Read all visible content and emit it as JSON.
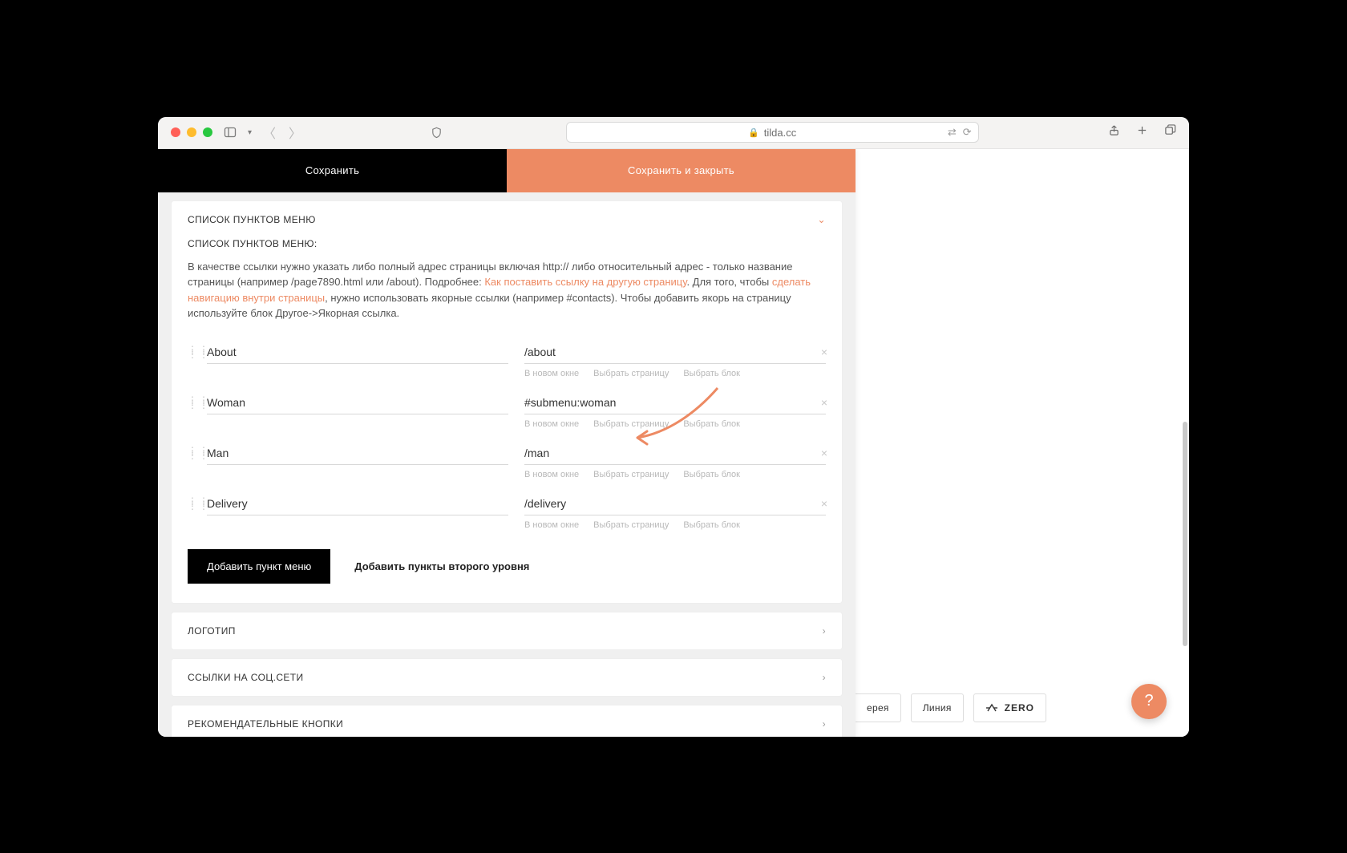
{
  "browser": {
    "url_host": "tilda.cc",
    "translate_icon": "translate-icon",
    "reload_icon": "reload-icon"
  },
  "modal": {
    "save_label": "Сохранить",
    "save_close_label": "Сохранить и закрыть"
  },
  "menu_section": {
    "title": "СПИСОК ПУНКТОВ МЕНЮ",
    "subtitle": "СПИСОК ПУНКТОВ МЕНЮ:",
    "help_pre": "В качестве ссылки нужно указать либо полный адрес страницы включая http:// либо относительный адрес - только название страницы (например /page7890.html или /about). Подробнее: ",
    "help_link1": "Как поставить ссылку на другую страницу",
    "help_mid": ". Для того, чтобы ",
    "help_link2": "сделать навигацию внутри страницы",
    "help_post": ", нужно использовать якорные ссылки (например #contacts). Чтобы добавить якорь на страницу используйте блок Другое->Якорная ссылка.",
    "opt_new_window": "В новом окне",
    "opt_select_page": "Выбрать страницу",
    "opt_select_block": "Выбрать блок",
    "items": [
      {
        "label": "About",
        "link": "/about"
      },
      {
        "label": "Woman",
        "link": "#submenu:woman"
      },
      {
        "label": "Man",
        "link": "/man"
      },
      {
        "label": "Delivery",
        "link": "/delivery"
      }
    ],
    "add_item": "Добавить пункт меню",
    "add_sub": "Добавить пункты второго уровня"
  },
  "other_sections": {
    "logo": "ЛОГОТИП",
    "social": "ССЫЛКИ НА СОЦ.СЕТИ",
    "rec_buttons": "РЕКОМЕНДАТЕЛЬНЫЕ КНОПКИ"
  },
  "right_tools": {
    "gallery_partial": "ерея",
    "line": "Линия",
    "zero": "ZERO"
  },
  "fab": {
    "label": "?"
  }
}
